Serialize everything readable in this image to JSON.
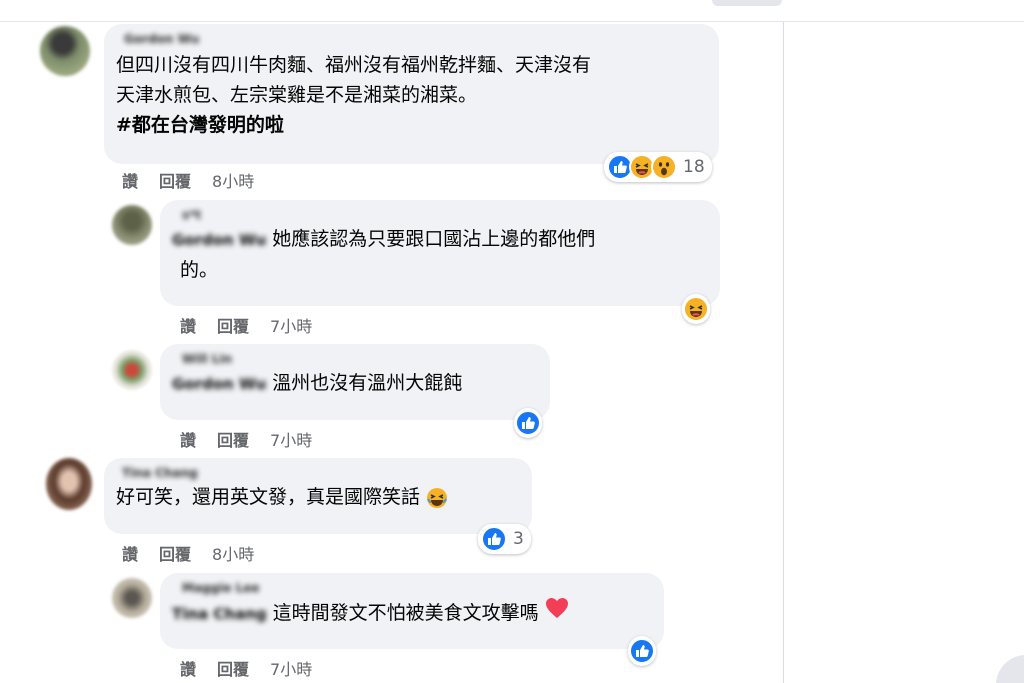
{
  "comments": [
    {
      "author": "Gordon Wu",
      "lines": [
        "但四川沒有四川牛肉麵、福州沒有福州乾拌麵、天津沒有",
        "天津水煎包、左宗棠雞是不是湘菜的湘菜。"
      ],
      "hashtag": "#都在台灣發明的啦",
      "actions": {
        "like": "讚",
        "reply": "回覆",
        "time": "8小時"
      },
      "reaction_count": "18"
    },
    {
      "author": "s*t",
      "mention": "Gordon Wu",
      "lines": [
        "她應該認為只要跟口國沾上邊的都他們",
        "的。"
      ],
      "actions": {
        "like": "讚",
        "reply": "回覆",
        "time": "7小時"
      }
    },
    {
      "author": "Will Lin",
      "mention": "Gordon Wu",
      "lines": [
        "溫州也沒有溫州大餛飩"
      ],
      "actions": {
        "like": "讚",
        "reply": "回覆",
        "time": "7小時"
      }
    },
    {
      "author": "Tina Chang",
      "lines": [
        "好可笑，還用英文發，真是國際笑話"
      ],
      "actions": {
        "like": "讚",
        "reply": "回覆",
        "time": "8小時"
      },
      "reaction_count": "3"
    },
    {
      "author": "Maggie Lee",
      "mention": "Tina Chang",
      "lines": [
        "這時間發文不怕被美食文攻擊嗎"
      ],
      "actions": {
        "like": "讚",
        "reply": "回覆",
        "time": "7小時"
      }
    }
  ],
  "colors": {
    "bubble": "#f0f2f5",
    "like_blue": "#1877f2",
    "muted_text": "#65676b",
    "emoji_yellow": "#f7b125",
    "heart_red": "#f33e58"
  },
  "icons": [
    "like-reaction-icon",
    "haha-reaction-icon",
    "wow-reaction-icon",
    "love-heart-icon",
    "laughing-emoji-icon"
  ]
}
